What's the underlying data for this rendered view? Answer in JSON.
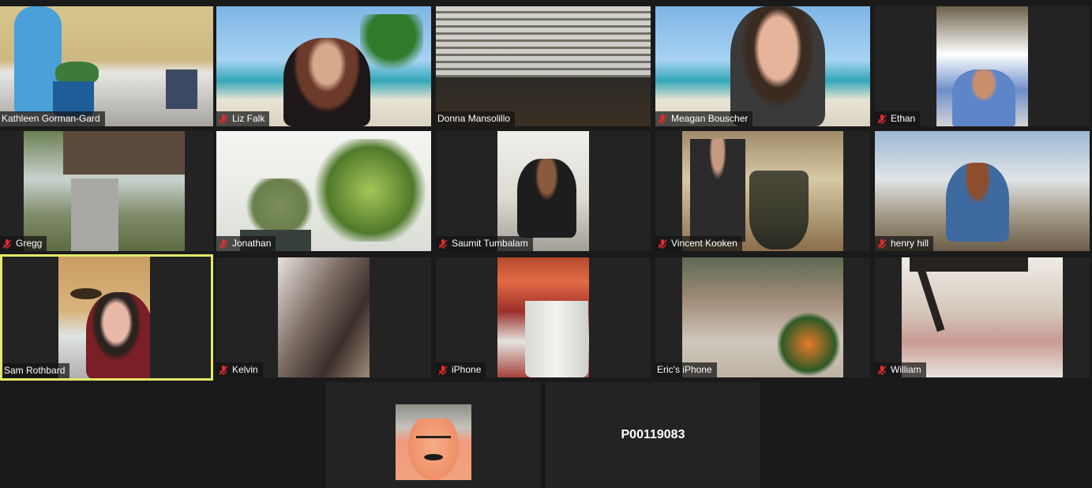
{
  "participants": [
    {
      "name": "Kathleen Gorman-Gard",
      "muted": false
    },
    {
      "name": "Liz Falk",
      "muted": true
    },
    {
      "name": "Donna Mansolillo",
      "muted": false
    },
    {
      "name": "Meagan Bouscher",
      "muted": true
    },
    {
      "name": "Ethan",
      "muted": true
    },
    {
      "name": "Gregg",
      "muted": true
    },
    {
      "name": "Jonathan",
      "muted": true
    },
    {
      "name": "Saumit Tumbalam",
      "muted": true
    },
    {
      "name": "Vincent Kooken",
      "muted": true
    },
    {
      "name": "henry hill",
      "muted": true
    },
    {
      "name": "Sam Rothbard",
      "muted": false,
      "active_speaker": true
    },
    {
      "name": "Kelvin",
      "muted": true
    },
    {
      "name": "iPhone",
      "muted": true
    },
    {
      "name": "Eric's iPhone",
      "muted": false
    },
    {
      "name": "William",
      "muted": true
    },
    {
      "name": "",
      "muted": false
    },
    {
      "name": "P00119083",
      "muted": false
    }
  ],
  "colors": {
    "background": "#1a1a1a",
    "tile": "#232323",
    "active_speaker_border": "#e4e86a",
    "muted_icon": "#e02d2d"
  },
  "icons": {
    "muted": "muted-microphone-icon"
  }
}
